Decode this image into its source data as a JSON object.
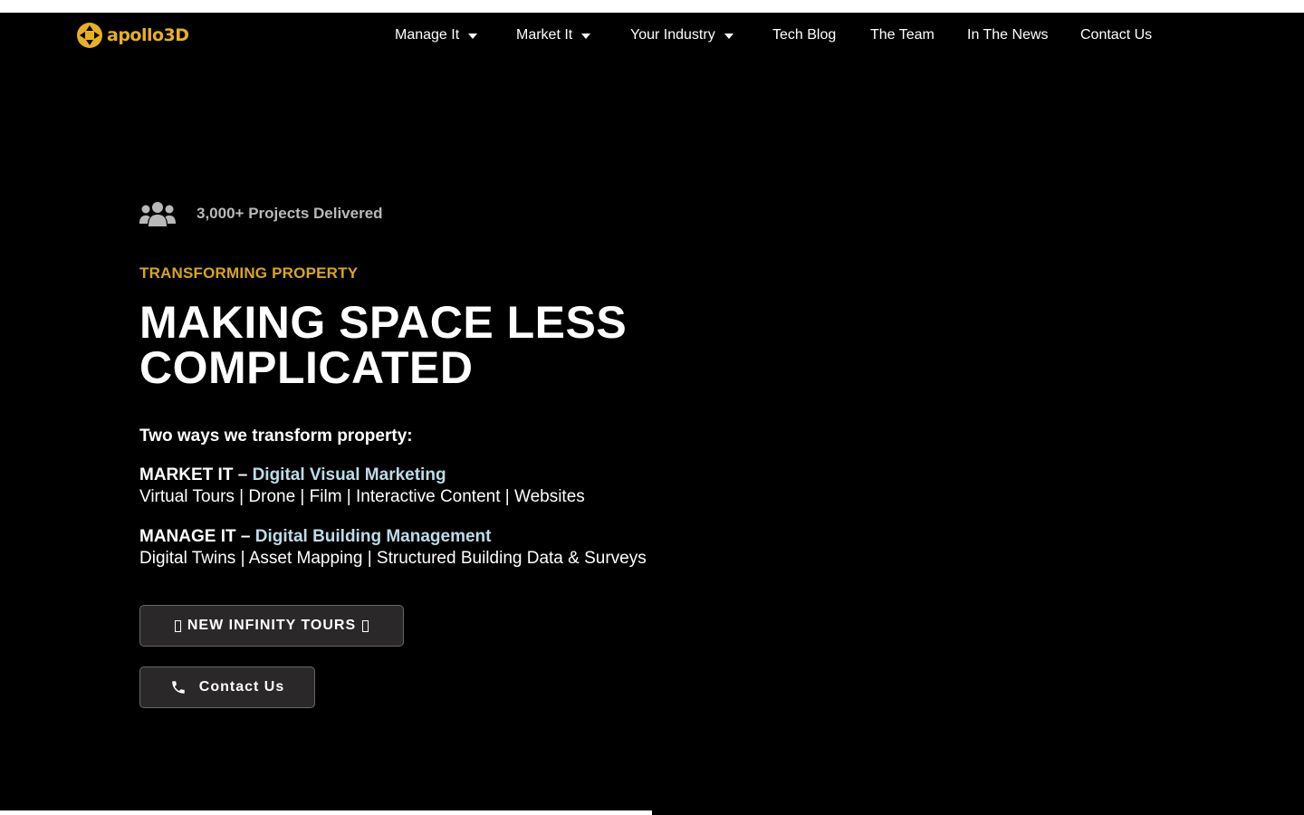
{
  "brand": {
    "name": "apollo3D",
    "color": "#e8b020"
  },
  "nav": {
    "items": [
      {
        "label": "Manage It",
        "has_dropdown": true
      },
      {
        "label": "Market It",
        "has_dropdown": true
      },
      {
        "label": "Your Industry",
        "has_dropdown": true
      },
      {
        "label": "Tech Blog",
        "has_dropdown": false
      },
      {
        "label": "The Team",
        "has_dropdown": false
      },
      {
        "label": "In The News",
        "has_dropdown": false
      },
      {
        "label": "Contact Us",
        "has_dropdown": false
      }
    ]
  },
  "hero": {
    "stat_icon": "users-icon",
    "stat": "3,000+ Projects Delivered",
    "eyebrow": "TRANSFORMING PROPERTY",
    "headline": "MAKING SPACE LESS COMPLICATED",
    "intro": "Two ways we transform property:",
    "market": {
      "label": "MARKET IT –",
      "link": "Digital Visual Marketing",
      "features": "Virtual Tours | Drone | Film | Interactive Content | Websites"
    },
    "manage": {
      "label": "MANAGE IT –",
      "link": "Digital Building Management",
      "features": "Digital Twins | Asset Mapping | Structured Building Data & Surveys"
    },
    "buttons": {
      "infinity": "NEW INFINITY TOURS",
      "contact": "Contact Us"
    }
  },
  "colors": {
    "background": "#000000",
    "accent": "#d9a521",
    "link": "#bcdce8",
    "button_bg": "#2a2828"
  }
}
